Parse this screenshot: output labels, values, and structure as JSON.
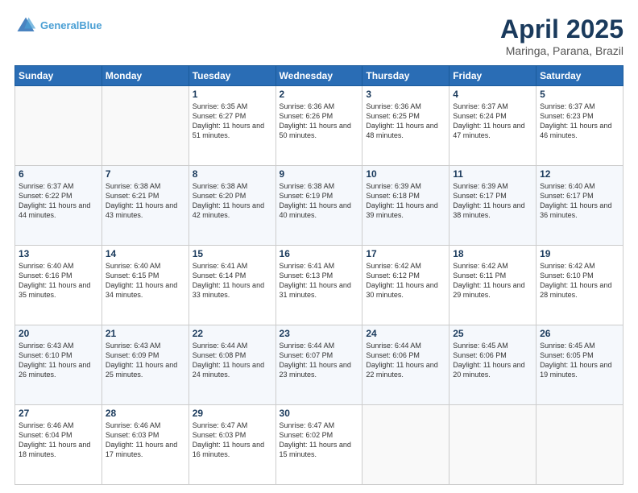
{
  "header": {
    "logo_line1": "General",
    "logo_line2": "Blue",
    "title": "April 2025",
    "subtitle": "Maringa, Parana, Brazil"
  },
  "weekdays": [
    "Sunday",
    "Monday",
    "Tuesday",
    "Wednesday",
    "Thursday",
    "Friday",
    "Saturday"
  ],
  "weeks": [
    [
      {
        "day": "",
        "info": ""
      },
      {
        "day": "",
        "info": ""
      },
      {
        "day": "1",
        "info": "Sunrise: 6:35 AM\nSunset: 6:27 PM\nDaylight: 11 hours and 51 minutes."
      },
      {
        "day": "2",
        "info": "Sunrise: 6:36 AM\nSunset: 6:26 PM\nDaylight: 11 hours and 50 minutes."
      },
      {
        "day": "3",
        "info": "Sunrise: 6:36 AM\nSunset: 6:25 PM\nDaylight: 11 hours and 48 minutes."
      },
      {
        "day": "4",
        "info": "Sunrise: 6:37 AM\nSunset: 6:24 PM\nDaylight: 11 hours and 47 minutes."
      },
      {
        "day": "5",
        "info": "Sunrise: 6:37 AM\nSunset: 6:23 PM\nDaylight: 11 hours and 46 minutes."
      }
    ],
    [
      {
        "day": "6",
        "info": "Sunrise: 6:37 AM\nSunset: 6:22 PM\nDaylight: 11 hours and 44 minutes."
      },
      {
        "day": "7",
        "info": "Sunrise: 6:38 AM\nSunset: 6:21 PM\nDaylight: 11 hours and 43 minutes."
      },
      {
        "day": "8",
        "info": "Sunrise: 6:38 AM\nSunset: 6:20 PM\nDaylight: 11 hours and 42 minutes."
      },
      {
        "day": "9",
        "info": "Sunrise: 6:38 AM\nSunset: 6:19 PM\nDaylight: 11 hours and 40 minutes."
      },
      {
        "day": "10",
        "info": "Sunrise: 6:39 AM\nSunset: 6:18 PM\nDaylight: 11 hours and 39 minutes."
      },
      {
        "day": "11",
        "info": "Sunrise: 6:39 AM\nSunset: 6:17 PM\nDaylight: 11 hours and 38 minutes."
      },
      {
        "day": "12",
        "info": "Sunrise: 6:40 AM\nSunset: 6:17 PM\nDaylight: 11 hours and 36 minutes."
      }
    ],
    [
      {
        "day": "13",
        "info": "Sunrise: 6:40 AM\nSunset: 6:16 PM\nDaylight: 11 hours and 35 minutes."
      },
      {
        "day": "14",
        "info": "Sunrise: 6:40 AM\nSunset: 6:15 PM\nDaylight: 11 hours and 34 minutes."
      },
      {
        "day": "15",
        "info": "Sunrise: 6:41 AM\nSunset: 6:14 PM\nDaylight: 11 hours and 33 minutes."
      },
      {
        "day": "16",
        "info": "Sunrise: 6:41 AM\nSunset: 6:13 PM\nDaylight: 11 hours and 31 minutes."
      },
      {
        "day": "17",
        "info": "Sunrise: 6:42 AM\nSunset: 6:12 PM\nDaylight: 11 hours and 30 minutes."
      },
      {
        "day": "18",
        "info": "Sunrise: 6:42 AM\nSunset: 6:11 PM\nDaylight: 11 hours and 29 minutes."
      },
      {
        "day": "19",
        "info": "Sunrise: 6:42 AM\nSunset: 6:10 PM\nDaylight: 11 hours and 28 minutes."
      }
    ],
    [
      {
        "day": "20",
        "info": "Sunrise: 6:43 AM\nSunset: 6:10 PM\nDaylight: 11 hours and 26 minutes."
      },
      {
        "day": "21",
        "info": "Sunrise: 6:43 AM\nSunset: 6:09 PM\nDaylight: 11 hours and 25 minutes."
      },
      {
        "day": "22",
        "info": "Sunrise: 6:44 AM\nSunset: 6:08 PM\nDaylight: 11 hours and 24 minutes."
      },
      {
        "day": "23",
        "info": "Sunrise: 6:44 AM\nSunset: 6:07 PM\nDaylight: 11 hours and 23 minutes."
      },
      {
        "day": "24",
        "info": "Sunrise: 6:44 AM\nSunset: 6:06 PM\nDaylight: 11 hours and 22 minutes."
      },
      {
        "day": "25",
        "info": "Sunrise: 6:45 AM\nSunset: 6:06 PM\nDaylight: 11 hours and 20 minutes."
      },
      {
        "day": "26",
        "info": "Sunrise: 6:45 AM\nSunset: 6:05 PM\nDaylight: 11 hours and 19 minutes."
      }
    ],
    [
      {
        "day": "27",
        "info": "Sunrise: 6:46 AM\nSunset: 6:04 PM\nDaylight: 11 hours and 18 minutes."
      },
      {
        "day": "28",
        "info": "Sunrise: 6:46 AM\nSunset: 6:03 PM\nDaylight: 11 hours and 17 minutes."
      },
      {
        "day": "29",
        "info": "Sunrise: 6:47 AM\nSunset: 6:03 PM\nDaylight: 11 hours and 16 minutes."
      },
      {
        "day": "30",
        "info": "Sunrise: 6:47 AM\nSunset: 6:02 PM\nDaylight: 11 hours and 15 minutes."
      },
      {
        "day": "",
        "info": ""
      },
      {
        "day": "",
        "info": ""
      },
      {
        "day": "",
        "info": ""
      }
    ]
  ]
}
